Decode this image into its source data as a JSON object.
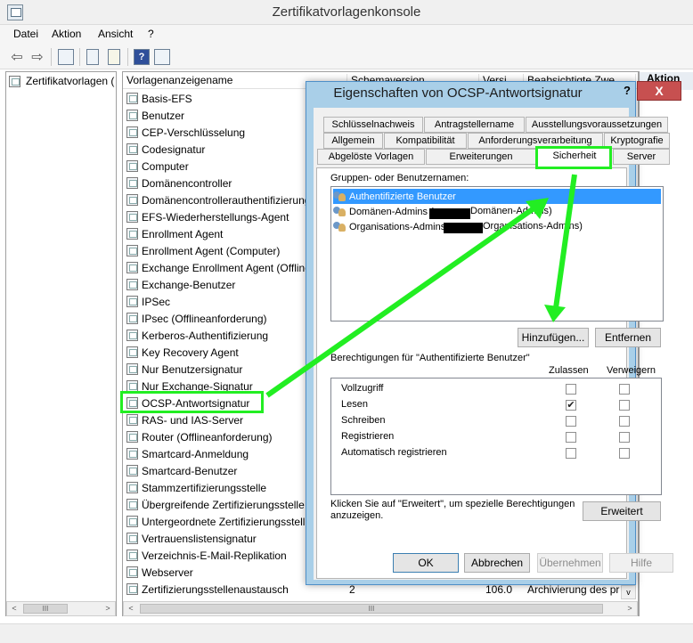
{
  "app": {
    "title": "Zertifikatvorlagenkonsole"
  },
  "menu": [
    "Datei",
    "Aktion",
    "Ansicht",
    "?"
  ],
  "tree": {
    "root": "Zertifikatvorlagen ("
  },
  "list": {
    "columns": [
      "Vorlagenanzeigename",
      "Schemaversion",
      "Versi",
      "Beabsichtigte Zwe"
    ],
    "items": [
      "Basis-EFS",
      "Benutzer",
      "CEP-Verschlüsselung",
      "Codesignatur",
      "Computer",
      "Domänencontroller",
      "Domänencontrollerauthentifizierung",
      "EFS-Wiederherstellungs-Agent",
      "Enrollment Agent",
      "Enrollment Agent (Computer)",
      "Exchange Enrollment Agent (Offline",
      "Exchange-Benutzer",
      "IPSec",
      "IPsec (Offlineanforderung)",
      "Kerberos-Authentifizierung",
      "Key Recovery Agent",
      "Nur Benutzersignatur",
      "Nur Exchange-Signatur",
      "OCSP-Antwortsignatur",
      "RAS- und IAS-Server",
      "Router (Offlineanforderung)",
      "Smartcard-Anmeldung",
      "Smartcard-Benutzer",
      "Stammzertifizierungsstelle",
      "Übergreifende Zertifizierungsstelle",
      "Untergeordnete Zertifizierungsstell",
      "Vertrauenslistensignatur",
      "Verzeichnis-E-Mail-Replikation",
      "Webserver",
      "Zertifizierungsstellenaustausch"
    ],
    "last_row_extra": {
      "schema": "2",
      "version": "106.0",
      "purpose": "Archivierung des pr"
    }
  },
  "actions": {
    "header": "Aktion"
  },
  "dialog": {
    "title": "Eigenschaften von OCSP-Antwortsignatur",
    "help": "?",
    "close": "X",
    "tabs_row1": [
      "Schlüsselnachweis",
      "Antragstellername",
      "Ausstellungsvoraussetzungen"
    ],
    "tabs_row2": [
      "Allgemein",
      "Kompatibilität",
      "Anforderungsverarbeitung",
      "Kryptografie"
    ],
    "tabs_row3": [
      "Abgelöste Vorlagen",
      "Erweiterungen",
      "Sicherheit",
      "Server"
    ],
    "groups_label": "Gruppen- oder Benutzernamen:",
    "principals": [
      {
        "name": "Authentifizierte Benutzer",
        "suffix": ""
      },
      {
        "name": "Domänen-Admins (",
        "suffix": "Domänen-Admins)"
      },
      {
        "name": "Organisations-Admins (",
        "suffix": "Organisations-Admins)"
      }
    ],
    "add_button": "Hinzufügen...",
    "remove_button": "Entfernen",
    "perms_label": "Berechtigungen für \"Authentifizierte Benutzer\"",
    "allow_header": "Zulassen",
    "deny_header": "Verweigern",
    "permissions": [
      {
        "name": "Vollzugriff",
        "allow": false,
        "deny": false
      },
      {
        "name": "Lesen",
        "allow": true,
        "deny": false
      },
      {
        "name": "Schreiben",
        "allow": false,
        "deny": false
      },
      {
        "name": "Registrieren",
        "allow": false,
        "deny": false
      },
      {
        "name": "Automatisch registrieren",
        "allow": false,
        "deny": false
      }
    ],
    "check_mark": "✔",
    "advanced_text_line1": "Klicken Sie auf \"Erweitert\", um spezielle Berechtigungen",
    "advanced_text_line2": "anzuzeigen.",
    "advanced_button": "Erweitert",
    "ok_button": "OK",
    "cancel_button": "Abbrechen",
    "apply_button": "Übernehmen",
    "help_button": "Hilfe"
  },
  "scroll": {
    "thumb": "III",
    "left": "<",
    "right": ">",
    "down": "v"
  },
  "colors": {
    "highlight": "#22ee22",
    "selection": "#3399ff",
    "dialog_frame": "#a9cfe8"
  }
}
